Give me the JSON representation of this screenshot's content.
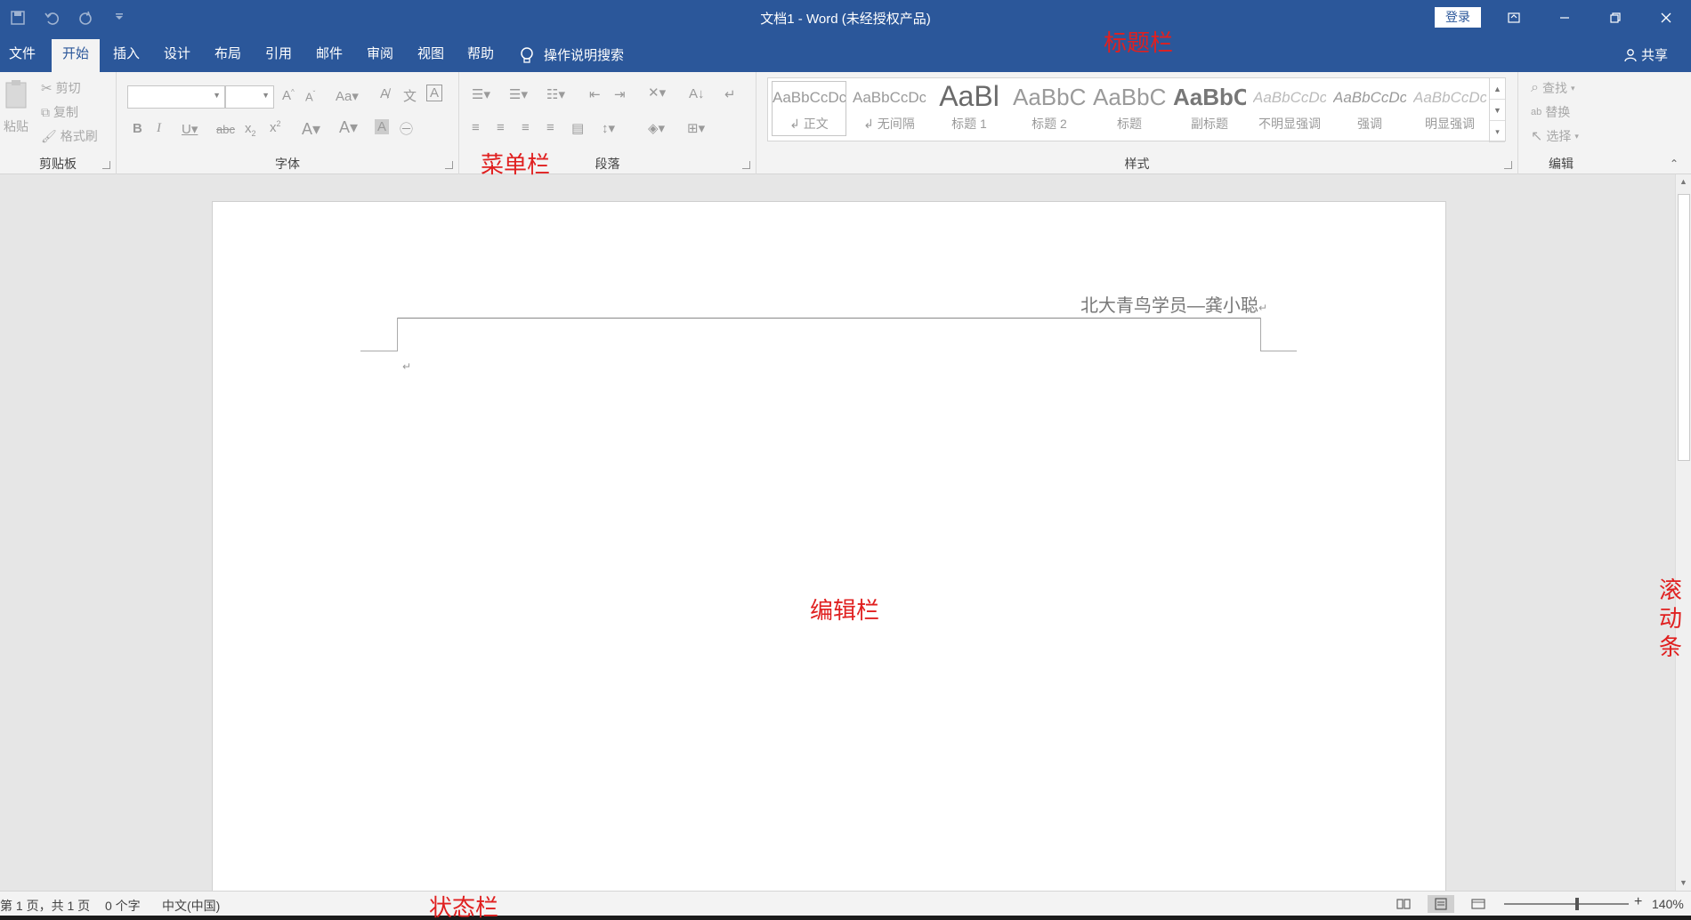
{
  "window": {
    "title": "文档1  -  Word (未经授权产品)",
    "login_label": "登录"
  },
  "tabs": [
    {
      "label": "文件"
    },
    {
      "label": "开始"
    },
    {
      "label": "插入"
    },
    {
      "label": "设计"
    },
    {
      "label": "布局"
    },
    {
      "label": "引用"
    },
    {
      "label": "邮件"
    },
    {
      "label": "审阅"
    },
    {
      "label": "视图"
    },
    {
      "label": "帮助"
    }
  ],
  "tell_me": "操作说明搜索",
  "share": "共享",
  "ribbon": {
    "clipboard": {
      "label": "剪贴板",
      "paste": "粘贴",
      "cut": "剪切",
      "copy": "复制",
      "format_painter": "格式刷"
    },
    "font": {
      "label": "字体"
    },
    "paragraph": {
      "label": "段落"
    },
    "styles": {
      "label": "样式",
      "items": [
        {
          "sample": "AaBbCcDc",
          "name": "↲ 正文"
        },
        {
          "sample": "AaBbCcDc",
          "name": "↲ 无间隔"
        },
        {
          "sample": "AaBl",
          "name": "标题 1"
        },
        {
          "sample": "AaBbC",
          "name": "标题 2"
        },
        {
          "sample": "AaBbC",
          "name": "标题"
        },
        {
          "sample": "AaBbC",
          "name": "副标题"
        },
        {
          "sample": "AaBbCcDc",
          "name": "不明显强调"
        },
        {
          "sample": "AaBbCcDc",
          "name": "强调"
        },
        {
          "sample": "AaBbCcDc",
          "name": "明显强调"
        }
      ]
    },
    "editing": {
      "label": "编辑",
      "find": "查找",
      "replace": "替换",
      "select": "选择"
    }
  },
  "document": {
    "header_text": "北大青鸟学员—龚小聪",
    "return_mark": "↵"
  },
  "status": {
    "page": "第 1 页，共 1 页",
    "words": "0 个字",
    "language": "中文(中国)",
    "zoom": "140%"
  },
  "annotations": {
    "title_bar": "标题栏",
    "menu_bar": "菜单栏",
    "edit_area": "编辑栏",
    "status_bar": "状态栏",
    "scrollbar": "滚动条"
  },
  "colors": {
    "accent": "#2b579a",
    "annotation": "#e02020"
  }
}
